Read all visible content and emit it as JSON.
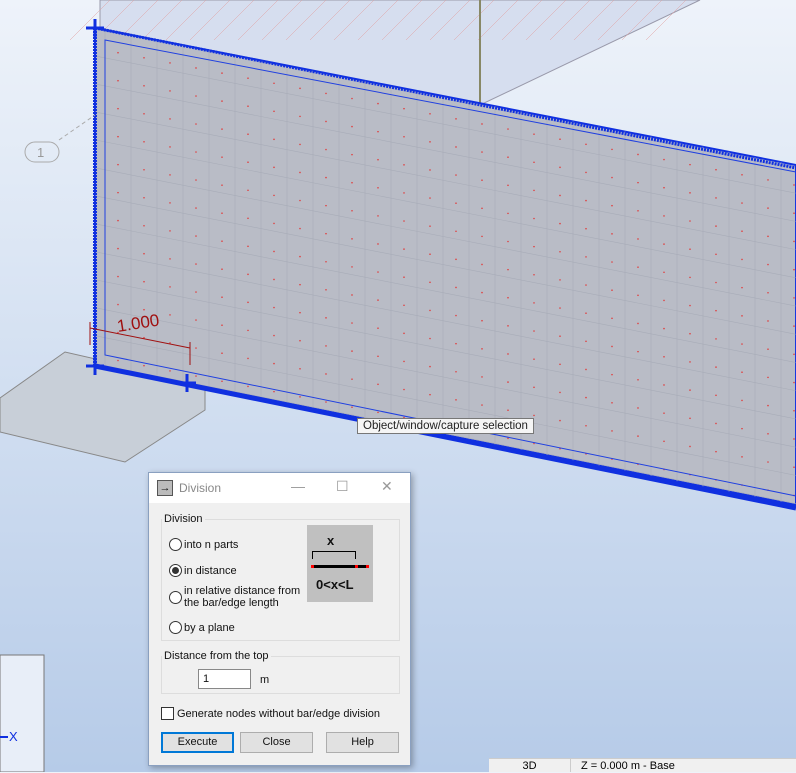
{
  "viewport": {
    "dimension_label": "1.000",
    "axis_label": "1",
    "x_axis": "X",
    "tooltip": "Object/window/capture selection"
  },
  "dialog": {
    "title": "Division",
    "division_group": "Division",
    "options": [
      "into n parts",
      "in distance",
      "in relative distance from the bar/edge length",
      "by a plane"
    ],
    "selected_option": "in distance",
    "diagram_label": "x",
    "diagram_formula": "0<x<L",
    "distance_group": "Distance from the top",
    "distance_value": "1",
    "distance_unit": "m",
    "checkbox_label": "Generate nodes without bar/edge division",
    "checkbox_checked": false,
    "buttons": {
      "execute": "Execute",
      "close": "Close",
      "help": "Help"
    }
  },
  "status_bar": {
    "view": "3D",
    "level": "Z = 0.000 m - Base"
  }
}
